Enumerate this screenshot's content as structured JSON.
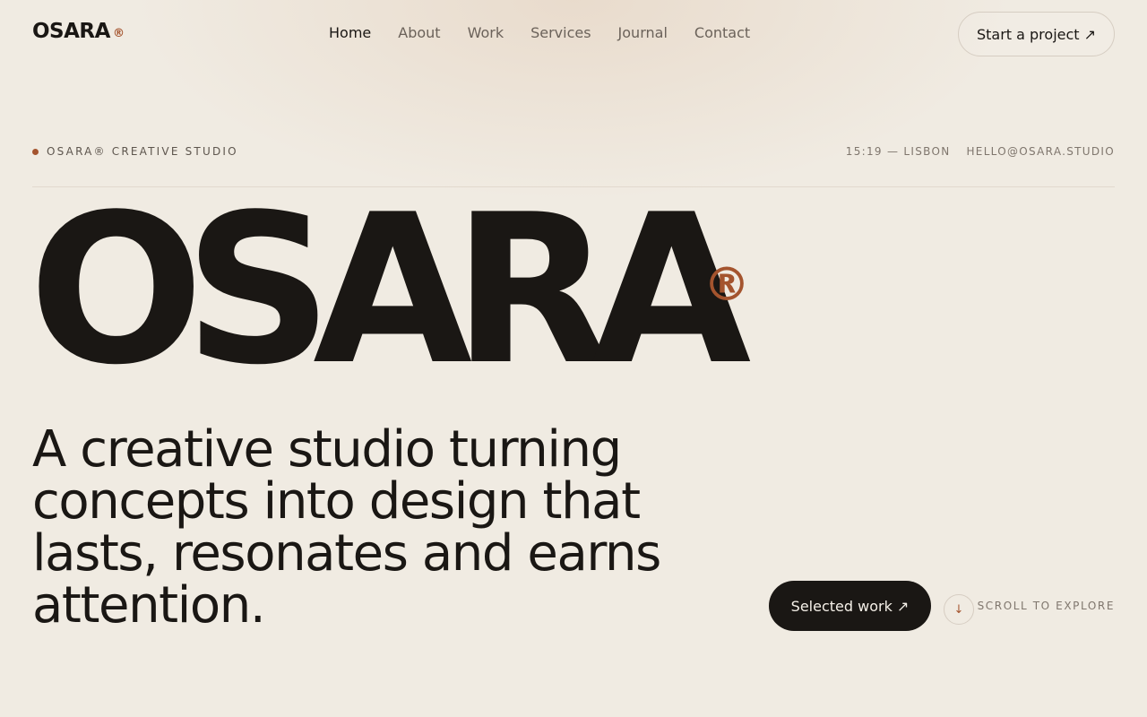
{
  "brand": {
    "name": "OSARA",
    "mark": "®"
  },
  "nav": {
    "items": [
      {
        "label": "Home",
        "active": true
      },
      {
        "label": "About",
        "active": false
      },
      {
        "label": "Work",
        "active": false
      },
      {
        "label": "Services",
        "active": false
      },
      {
        "label": "Journal",
        "active": false
      },
      {
        "label": "Contact",
        "active": false
      }
    ],
    "cta_label": "Start a project ↗"
  },
  "meta": {
    "studio_label": "OSARA® CREATIVE STUDIO",
    "time_location": "15:19 — LISBON",
    "email": "HELLO@OSARA.STUDIO"
  },
  "hero": {
    "word": "OSARA",
    "mark": "®",
    "tagline": "A creative studio turning concepts into design that lasts, resonates and earns attention.",
    "primary_button": "Selected work ↗",
    "scroll_arrow": "↓",
    "scroll_label": "SCROLL TO EXPLORE"
  },
  "colors": {
    "background": "#f0ebe2",
    "ink": "#1a1714",
    "accent": "#a4542e",
    "muted": "#7f766d"
  },
  "icons": {
    "arrow_up_right": "↗",
    "arrow_down": "↓"
  }
}
